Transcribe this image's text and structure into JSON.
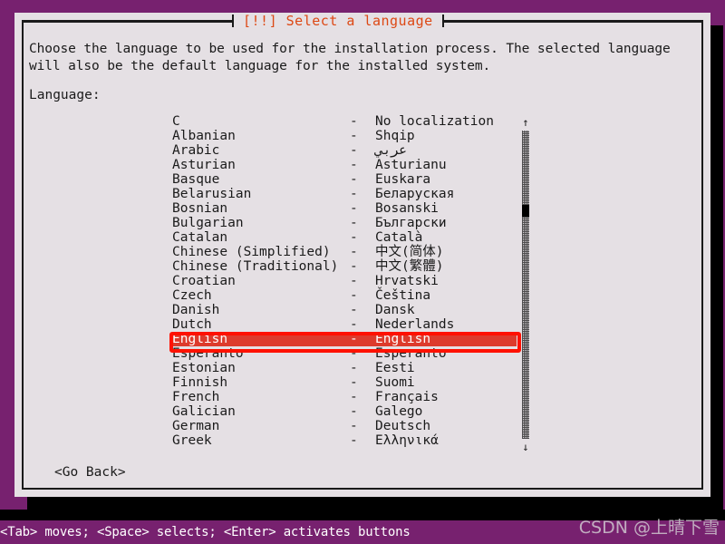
{
  "screen": {
    "background_color": "#77216f",
    "dialog_background": "#e5e0e4",
    "title_color": "#dd4814",
    "selection_color": "#dd3b2c",
    "annotation_color": "#ff1100"
  },
  "dialog": {
    "title": "[!!] Select a language",
    "intro": "Choose the language to be used for the installation process. The selected language will also be the default language for the installed system.",
    "language_label": "Language:",
    "go_back_button": "<Go Back>"
  },
  "scrollbar": {
    "up_arrow": "↑",
    "down_arrow": "↓"
  },
  "languages": [
    {
      "english": "C",
      "dash": "-",
      "native": "No localization",
      "selected": false
    },
    {
      "english": "Albanian",
      "dash": "-",
      "native": "Shqip",
      "selected": false
    },
    {
      "english": "Arabic",
      "dash": "-",
      "native": "عربي",
      "selected": false
    },
    {
      "english": "Asturian",
      "dash": "-",
      "native": "Asturianu",
      "selected": false
    },
    {
      "english": "Basque",
      "dash": "-",
      "native": "Euskara",
      "selected": false
    },
    {
      "english": "Belarusian",
      "dash": "-",
      "native": "Беларуская",
      "selected": false
    },
    {
      "english": "Bosnian",
      "dash": "-",
      "native": "Bosanski",
      "selected": false
    },
    {
      "english": "Bulgarian",
      "dash": "-",
      "native": "Български",
      "selected": false
    },
    {
      "english": "Catalan",
      "dash": "-",
      "native": "Català",
      "selected": false
    },
    {
      "english": "Chinese (Simplified)",
      "dash": "-",
      "native": "中文(简体)",
      "selected": false
    },
    {
      "english": "Chinese (Traditional)",
      "dash": "-",
      "native": "中文(繁體)",
      "selected": false
    },
    {
      "english": "Croatian",
      "dash": "-",
      "native": "Hrvatski",
      "selected": false
    },
    {
      "english": "Czech",
      "dash": "-",
      "native": "Čeština",
      "selected": false
    },
    {
      "english": "Danish",
      "dash": "-",
      "native": "Dansk",
      "selected": false
    },
    {
      "english": "Dutch",
      "dash": "-",
      "native": "Nederlands",
      "selected": false
    },
    {
      "english": "English",
      "dash": "-",
      "native": "English",
      "selected": true
    },
    {
      "english": "Esperanto",
      "dash": "-",
      "native": "Esperanto",
      "selected": false
    },
    {
      "english": "Estonian",
      "dash": "-",
      "native": "Eesti",
      "selected": false
    },
    {
      "english": "Finnish",
      "dash": "-",
      "native": "Suomi",
      "selected": false
    },
    {
      "english": "French",
      "dash": "-",
      "native": "Français",
      "selected": false
    },
    {
      "english": "Galician",
      "dash": "-",
      "native": "Galego",
      "selected": false
    },
    {
      "english": "German",
      "dash": "-",
      "native": "Deutsch",
      "selected": false
    },
    {
      "english": "Greek",
      "dash": "-",
      "native": "Ελληνικά",
      "selected": false
    }
  ],
  "statusbar": {
    "hints": "<Tab> moves; <Space> selects; <Enter> activates buttons"
  },
  "watermark": {
    "text": "CSDN @上晴下雪"
  }
}
